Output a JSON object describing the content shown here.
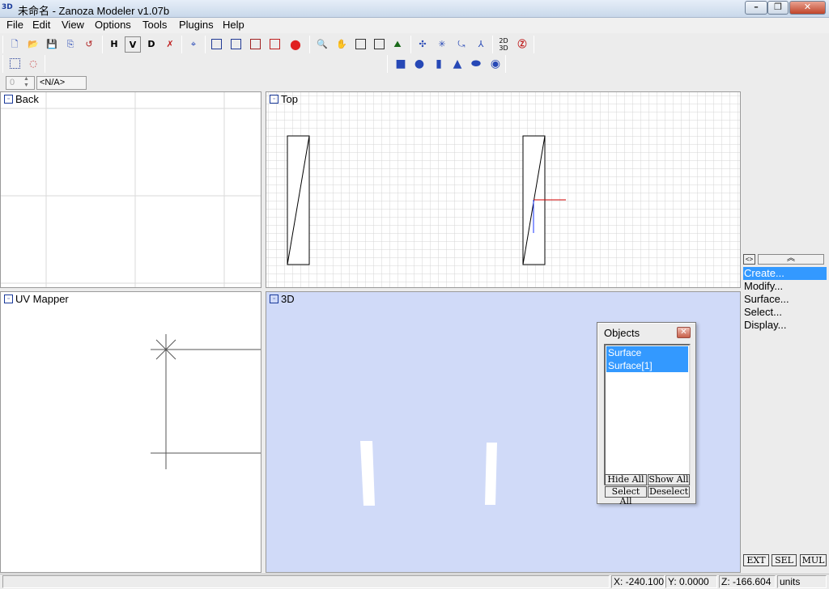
{
  "window": {
    "title": "未命名 - Zanoza Modeler v1.07b",
    "app_icon": "3D"
  },
  "menu": [
    "File",
    "Edit",
    "View",
    "Options",
    "Tools",
    "Plugins",
    "Help"
  ],
  "toolbar": {
    "view_h": "H",
    "view_v": "V",
    "view_d": "D",
    "label_2d3d": "2D 3D",
    "spinner_value": "0",
    "na_label": "<N/A>"
  },
  "panels": {
    "back": "Back",
    "top": "Top",
    "uv": "UV Mapper",
    "view3d": "3D"
  },
  "side_panel": {
    "toggle_label": "<>",
    "items": [
      "Create...",
      "Modify...",
      "Surface...",
      "Select...",
      "Display..."
    ],
    "active_index": 0
  },
  "objects_window": {
    "title": "Objects",
    "items": [
      "Surface",
      "Surface[1]"
    ],
    "buttons": {
      "hide_all": "Hide All",
      "show_all": "Show All",
      "select_all": "Select All",
      "deselect": "Deselect"
    }
  },
  "mode_buttons": [
    "EXT",
    "SEL",
    "MUL"
  ],
  "status": {
    "x": "X: -240.100",
    "y": "Y: 0.0000",
    "z": "Z: -166.604",
    "units": "units"
  },
  "colors": {
    "view3d_bg": "#d0daf8",
    "grid_line": "#d6d6d6",
    "selection": "#3399ff",
    "axis_red": "#d00000",
    "axis_blue": "#1a35ff"
  }
}
